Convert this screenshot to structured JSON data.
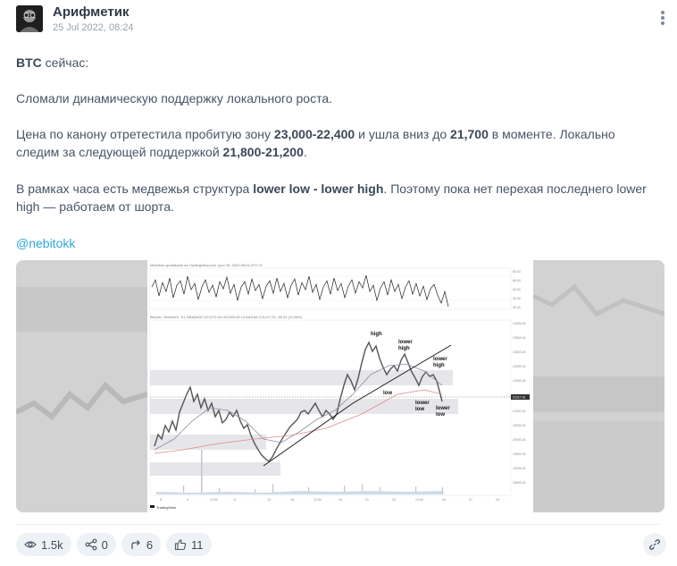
{
  "post": {
    "author": "Арифметик",
    "date": "25 Jul 2022, 08:24",
    "menu_icon": "more-vertical-icon"
  },
  "content": {
    "line1_bold": "BTC",
    "line1_rest": " сейчас:",
    "line2": "Сломали динамическую поддержку локального роста.",
    "p3_a": "Цена по канону отретестила пробитую зону ",
    "p3_b": "23,000-22,400",
    "p3_c": " и ушла вниз до ",
    "p3_d": "21,700",
    "p3_e": " в моменте. Локально следим за следующей поддержкой ",
    "p3_f": "21,800-21,200",
    "p3_g": ".",
    "p4_a": "В рамках часа есть медвежья структура ",
    "p4_b": "lower low - lower high",
    "p4_c": ". Поэтому пока нет перехая последнего lower high — работаем от шорта.",
    "mention": "@nebitokk"
  },
  "chart_labels": {
    "high": "high",
    "lower_high_1": "lower\nhigh",
    "lower_high_2": "lower\nhigh",
    "low": "low",
    "lower_low_1": "lower\nlow",
    "lower_low_2": "lower\nlow",
    "tv_logo": "TradingView"
  },
  "stats": {
    "views": "1.5k",
    "reposts": "0",
    "shares": "6",
    "likes": "11"
  },
  "icons": {
    "views": "eye-icon",
    "reposts": "repost-icon",
    "shares": "share-arrow-icon",
    "likes": "thumbs-up-icon",
    "link": "link-icon"
  },
  "colors": {
    "mention": "#2fa7d8",
    "pill_bg": "#eef2f6",
    "price_line": "#4d4d4d",
    "ma_line": "#8a8fa3",
    "ma_red": "#e08a8a"
  }
}
